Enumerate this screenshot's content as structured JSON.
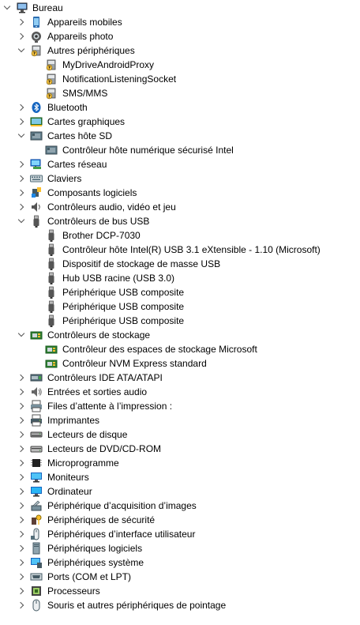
{
  "root": {
    "label": "Bureau",
    "icon": "computer-icon"
  },
  "categories": [
    {
      "label": "Appareils mobiles",
      "icon": "mobile-device-icon",
      "expanded": false,
      "children": []
    },
    {
      "label": "Appareils photo",
      "icon": "camera-icon",
      "expanded": false,
      "children": []
    },
    {
      "label": "Autres périphériques",
      "icon": "unknown-device-icon",
      "expanded": true,
      "children": [
        {
          "label": "MyDriveAndroidProxy",
          "icon": "unknown-device-icon"
        },
        {
          "label": "NotificationListeningSocket",
          "icon": "unknown-device-icon"
        },
        {
          "label": "SMS/MMS",
          "icon": "unknown-device-icon"
        }
      ]
    },
    {
      "label": "Bluetooth",
      "icon": "bluetooth-icon",
      "expanded": false,
      "children": []
    },
    {
      "label": "Cartes graphiques",
      "icon": "graphics-card-icon",
      "expanded": false,
      "children": []
    },
    {
      "label": "Cartes hôte SD",
      "icon": "sd-host-icon",
      "expanded": true,
      "children": [
        {
          "label": "Contrôleur hôte numérique sécurisé Intel",
          "icon": "sd-host-icon"
        }
      ]
    },
    {
      "label": "Cartes réseau",
      "icon": "network-adapter-icon",
      "expanded": false,
      "children": []
    },
    {
      "label": "Claviers",
      "icon": "keyboard-icon",
      "expanded": false,
      "children": []
    },
    {
      "label": "Composants logiciels",
      "icon": "software-component-icon",
      "expanded": false,
      "children": []
    },
    {
      "label": "Contrôleurs audio, vidéo et jeu",
      "icon": "speaker-icon",
      "expanded": false,
      "children": []
    },
    {
      "label": "Contrôleurs de bus USB",
      "icon": "usb-icon",
      "expanded": true,
      "children": [
        {
          "label": "Brother DCP-7030",
          "icon": "usb-icon"
        },
        {
          "label": "Contrôleur hôte Intel(R) USB 3.1 eXtensible - 1.10 (Microsoft)",
          "icon": "usb-icon"
        },
        {
          "label": "Dispositif de stockage de masse USB",
          "icon": "usb-icon"
        },
        {
          "label": "Hub USB racine (USB 3.0)",
          "icon": "usb-icon"
        },
        {
          "label": "Périphérique USB composite",
          "icon": "usb-icon"
        },
        {
          "label": "Périphérique USB composite",
          "icon": "usb-icon"
        },
        {
          "label": "Périphérique USB composite",
          "icon": "usb-icon"
        }
      ]
    },
    {
      "label": "Contrôleurs de stockage",
      "icon": "storage-controller-icon",
      "expanded": true,
      "children": [
        {
          "label": "Contrôleur des espaces de stockage Microsoft",
          "icon": "storage-controller-icon"
        },
        {
          "label": "Contrôleur NVM Express standard",
          "icon": "storage-controller-icon"
        }
      ]
    },
    {
      "label": "Contrôleurs IDE ATA/ATAPI",
      "icon": "ide-controller-icon",
      "expanded": false,
      "children": []
    },
    {
      "label": "Entrées et sorties audio",
      "icon": "audio-io-icon",
      "expanded": false,
      "children": []
    },
    {
      "label": "Files d’attente à l’impression :",
      "icon": "print-queue-icon",
      "expanded": false,
      "children": []
    },
    {
      "label": "Imprimantes",
      "icon": "printer-icon",
      "expanded": false,
      "children": []
    },
    {
      "label": "Lecteurs de disque",
      "icon": "disk-drive-icon",
      "expanded": false,
      "children": []
    },
    {
      "label": "Lecteurs de DVD/CD-ROM",
      "icon": "dvd-drive-icon",
      "expanded": false,
      "children": []
    },
    {
      "label": "Microprogramme",
      "icon": "firmware-icon",
      "expanded": false,
      "children": []
    },
    {
      "label": "Moniteurs",
      "icon": "monitor-icon",
      "expanded": false,
      "children": []
    },
    {
      "label": "Ordinateur",
      "icon": "computer-monitor-icon",
      "expanded": false,
      "children": []
    },
    {
      "label": "Périphérique d’acquisition d’images",
      "icon": "imaging-device-icon",
      "expanded": false,
      "children": []
    },
    {
      "label": "Périphériques de sécurité",
      "icon": "security-device-icon",
      "expanded": false,
      "children": []
    },
    {
      "label": "Périphériques d’interface utilisateur",
      "icon": "hid-icon",
      "expanded": false,
      "children": []
    },
    {
      "label": "Périphériques logiciels",
      "icon": "software-device-icon",
      "expanded": false,
      "children": []
    },
    {
      "label": "Périphériques système",
      "icon": "system-device-icon",
      "expanded": false,
      "children": []
    },
    {
      "label": "Ports (COM et LPT)",
      "icon": "port-icon",
      "expanded": false,
      "children": []
    },
    {
      "label": "Processeurs",
      "icon": "processor-icon",
      "expanded": false,
      "children": []
    },
    {
      "label": "Souris et autres périphériques de pointage",
      "icon": "mouse-icon",
      "expanded": false,
      "children": []
    }
  ]
}
